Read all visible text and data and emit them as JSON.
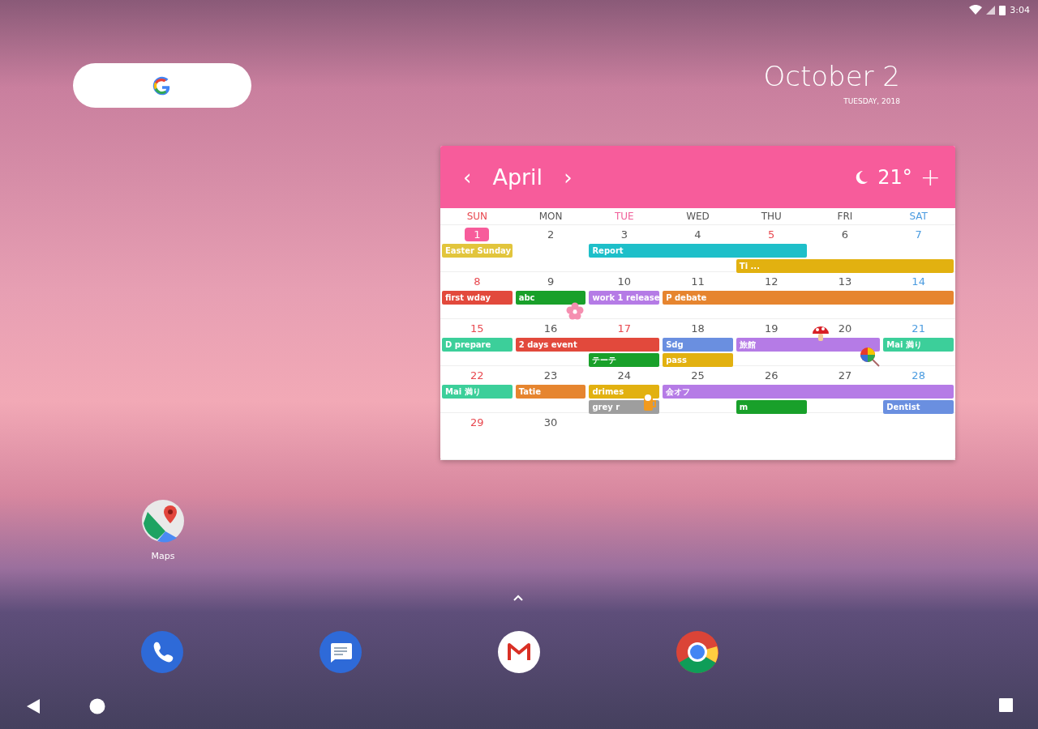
{
  "status_bar": {
    "time": "3:04"
  },
  "clock_widget": {
    "date": "October 2",
    "subtitle": "TUESDAY, 2018"
  },
  "calendar_widget": {
    "prev": "‹",
    "month": "April",
    "next": "›",
    "temperature": "21°",
    "add": "+",
    "weekdays": [
      {
        "label": "SUN",
        "kind": "holiday"
      },
      {
        "label": "MON",
        "kind": "weekday"
      },
      {
        "label": "TUE",
        "kind": "pink"
      },
      {
        "label": "WED",
        "kind": "weekday"
      },
      {
        "label": "THU",
        "kind": "weekday"
      },
      {
        "label": "FRI",
        "kind": "weekday"
      },
      {
        "label": "SAT",
        "kind": "saturday"
      }
    ],
    "weeks": [
      {
        "days": [
          {
            "number": "1",
            "kind": "holiday",
            "selected": true
          },
          {
            "number": "2",
            "kind": "weekday",
            "selected": false
          },
          {
            "number": "3",
            "kind": "weekday",
            "selected": false
          },
          {
            "number": "4",
            "kind": "weekday",
            "selected": false
          },
          {
            "number": "5",
            "kind": "holiday",
            "selected": false
          },
          {
            "number": "6",
            "kind": "weekday",
            "selected": false
          },
          {
            "number": "7",
            "kind": "saturday",
            "selected": false
          }
        ],
        "events": [
          {
            "title": "Easter Sunday",
            "color": "#e2c53c"
          },
          {
            "title": "Report",
            "color": "#1ebfc9"
          },
          {
            "title": "Ti ...",
            "color": "#e2b110"
          }
        ]
      },
      {
        "days": [
          {
            "number": "8",
            "kind": "holiday",
            "selected": false
          },
          {
            "number": "9",
            "kind": "weekday",
            "selected": false
          },
          {
            "number": "10",
            "kind": "weekday",
            "selected": false
          },
          {
            "number": "11",
            "kind": "weekday",
            "selected": false
          },
          {
            "number": "12",
            "kind": "weekday",
            "selected": false
          },
          {
            "number": "13",
            "kind": "weekday",
            "selected": false
          },
          {
            "number": "14",
            "kind": "saturday",
            "selected": false
          }
        ],
        "events": [
          {
            "title": "first wday",
            "color": "#e2493c"
          },
          {
            "title": "abc",
            "color": "#19a02a"
          },
          {
            "title": "work 1 release",
            "color": "#b57be6"
          },
          {
            "title": "P debate",
            "color": "#e6852f"
          }
        ]
      },
      {
        "days": [
          {
            "number": "15",
            "kind": "holiday",
            "selected": false
          },
          {
            "number": "16",
            "kind": "weekday",
            "selected": false
          },
          {
            "number": "17",
            "kind": "holiday",
            "selected": false
          },
          {
            "number": "18",
            "kind": "weekday",
            "selected": false
          },
          {
            "number": "19",
            "kind": "weekday",
            "selected": false
          },
          {
            "number": "20",
            "kind": "weekday",
            "selected": false
          },
          {
            "number": "21",
            "kind": "saturday",
            "selected": false
          }
        ],
        "events": [
          {
            "title": "D prepare",
            "color": "#3ccf9a"
          },
          {
            "title": "2 days event",
            "color": "#e2493c"
          },
          {
            "title": "Sdg",
            "color": "#6a8fe0"
          },
          {
            "title": "旅館",
            "color": "#b57be6"
          },
          {
            "title": "Mai 満り",
            "color": "#3ccf9a"
          },
          {
            "title": "テーテ",
            "color": "#19a02a"
          },
          {
            "title": "pass",
            "color": "#e2b110"
          }
        ]
      },
      {
        "days": [
          {
            "number": "22",
            "kind": "holiday",
            "selected": false
          },
          {
            "number": "23",
            "kind": "weekday",
            "selected": false
          },
          {
            "number": "24",
            "kind": "weekday",
            "selected": false
          },
          {
            "number": "25",
            "kind": "weekday",
            "selected": false
          },
          {
            "number": "26",
            "kind": "weekday",
            "selected": false
          },
          {
            "number": "27",
            "kind": "weekday",
            "selected": false
          },
          {
            "number": "28",
            "kind": "saturday",
            "selected": false
          }
        ],
        "events": [
          {
            "title": "Mai 満り",
            "color": "#3ccf9a"
          },
          {
            "title": "Tatie",
            "color": "#e6852f"
          },
          {
            "title": "drimes",
            "color": "#e2b110"
          },
          {
            "title": "会オフ",
            "color": "#b57be6"
          },
          {
            "title": "grey r",
            "color": "#9e9e9e"
          },
          {
            "title": "m",
            "color": "#19a02a"
          },
          {
            "title": "Dentist",
            "color": "#6a8fe0"
          }
        ]
      },
      {
        "days": [
          {
            "number": "29",
            "kind": "holiday",
            "selected": false
          },
          {
            "number": "30",
            "kind": "weekday",
            "selected": false
          }
        ]
      }
    ]
  },
  "apps": [
    {
      "label": "Maps"
    }
  ],
  "dock": [
    {
      "kind": "phone"
    },
    {
      "kind": "messages"
    },
    {
      "kind": "mail"
    },
    {
      "kind": "browser"
    }
  ]
}
